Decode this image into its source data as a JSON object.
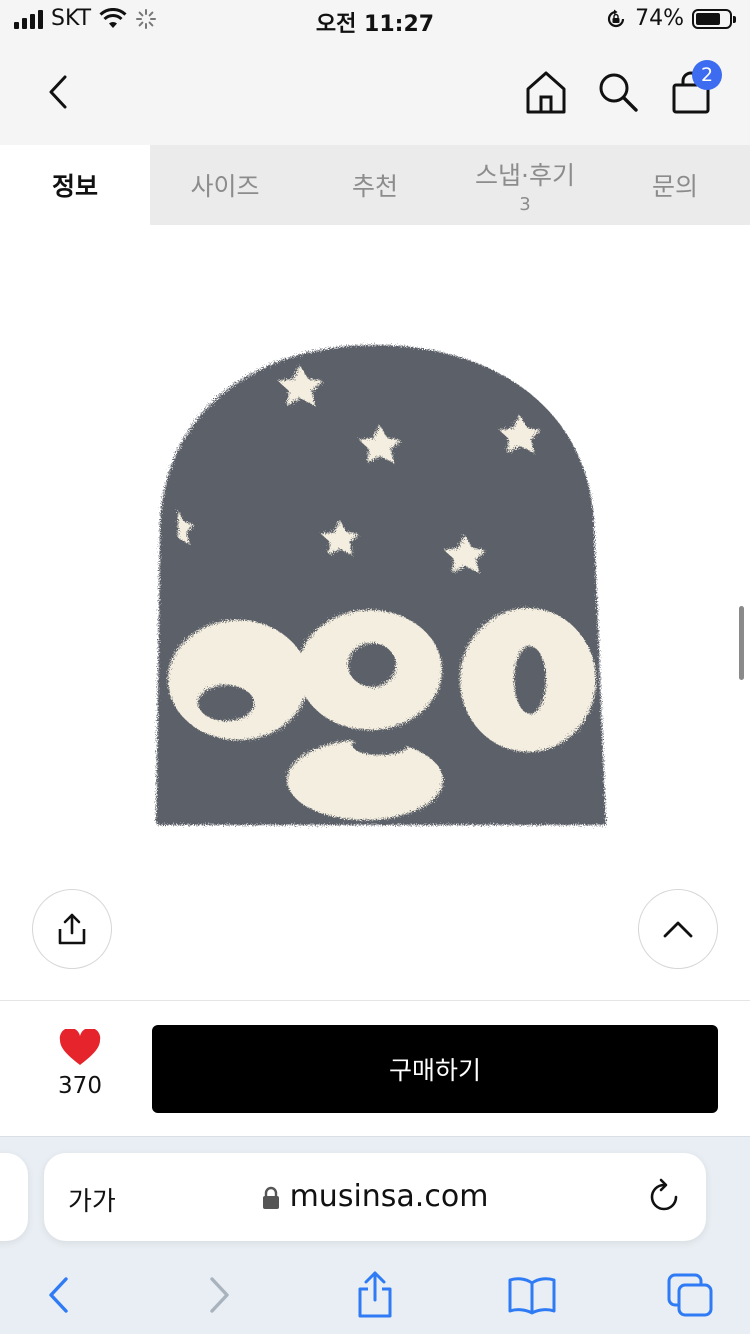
{
  "status_bar": {
    "carrier": "SKT",
    "time": "오전 11:27",
    "battery": "74%",
    "battery_level": 0.74
  },
  "nav": {
    "cart_count": "2",
    "badge_color": "#3d6cf0"
  },
  "tabs": [
    {
      "label": "정보",
      "count": "",
      "active": true
    },
    {
      "label": "사이즈",
      "count": "",
      "active": false
    },
    {
      "label": "추천",
      "count": "",
      "active": false
    },
    {
      "label": "스냅·후기",
      "count": "3",
      "active": false
    },
    {
      "label": "문의",
      "count": "",
      "active": false
    }
  ],
  "product": {
    "image_text": "ago",
    "beanie_color": "#5b6068",
    "print_color": "#f3eee0"
  },
  "purchase": {
    "like_count": "370",
    "heart_color": "#e5242b",
    "buy_label": "구매하기"
  },
  "browser": {
    "text_size_label": "가가",
    "url": "musinsa.com",
    "accent": "#2f7bf5"
  },
  "icons": [
    "back-chevron-icon",
    "home-icon",
    "search-icon",
    "shopping-bag-icon",
    "share-icon",
    "chevron-up-icon",
    "heart-icon",
    "lock-icon",
    "reload-icon",
    "forward-chevron-icon",
    "bookmarks-icon",
    "tabs-icon"
  ]
}
